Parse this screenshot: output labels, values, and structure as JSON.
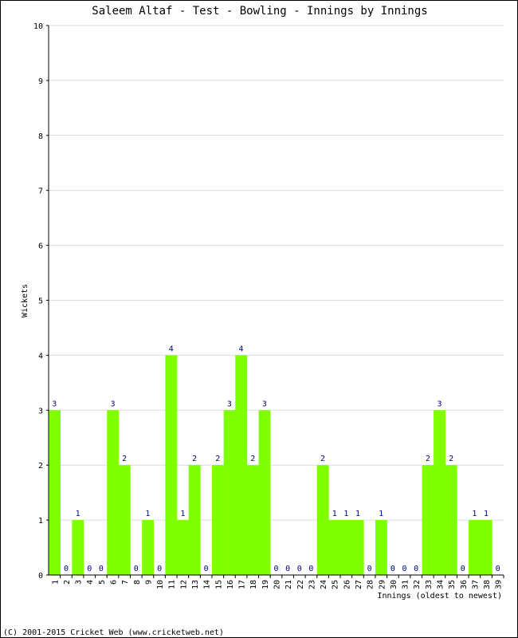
{
  "chart_data": {
    "type": "bar",
    "title": "Saleem Altaf - Test - Bowling - Innings by Innings",
    "xlabel": "Innings (oldest to newest)",
    "ylabel": "Wickets",
    "ylim": [
      0,
      10
    ],
    "yticks": [
      0,
      1,
      2,
      3,
      4,
      5,
      6,
      7,
      8,
      9,
      10
    ],
    "grid": true,
    "bar_color": "#7fff00",
    "label_color": "#000080",
    "categories": [
      "1",
      "2",
      "3",
      "4",
      "5",
      "6",
      "7",
      "8",
      "9",
      "10",
      "11",
      "12",
      "13",
      "14",
      "15",
      "16",
      "17",
      "18",
      "19",
      "20",
      "21",
      "22",
      "23",
      "24",
      "25",
      "26",
      "27",
      "28",
      "29",
      "30",
      "31",
      "32",
      "33",
      "34",
      "35",
      "36",
      "37",
      "38",
      "39"
    ],
    "values": [
      3,
      0,
      1,
      0,
      0,
      3,
      2,
      0,
      1,
      0,
      4,
      1,
      2,
      0,
      2,
      3,
      4,
      2,
      3,
      0,
      0,
      0,
      0,
      2,
      1,
      1,
      1,
      0,
      1,
      0,
      0,
      0,
      2,
      3,
      2,
      0,
      1,
      1,
      0
    ]
  },
  "footer": "(C) 2001-2015 Cricket Web (www.cricketweb.net)"
}
